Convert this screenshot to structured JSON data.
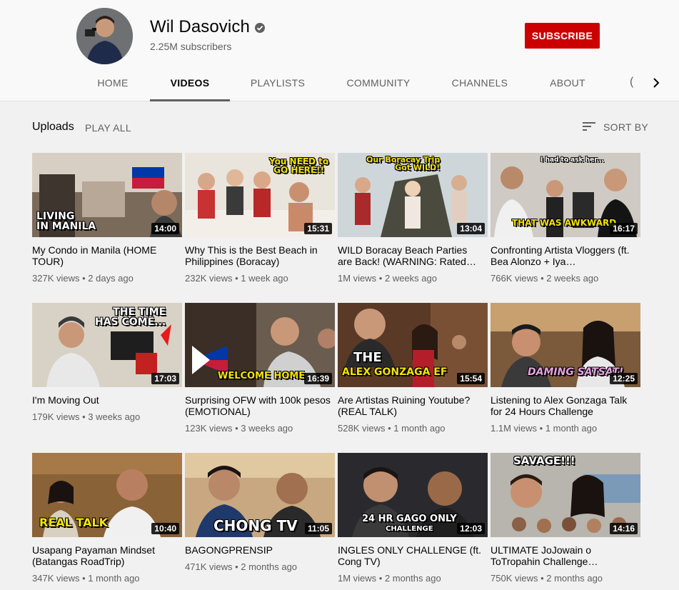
{
  "channel": {
    "name": "Wil Dasovich",
    "subscribers": "2.25M subscribers",
    "subscribe_label": "SUBSCRIBE"
  },
  "tabs": [
    {
      "label": "HOME"
    },
    {
      "label": "VIDEOS"
    },
    {
      "label": "PLAYLISTS"
    },
    {
      "label": "COMMUNITY"
    },
    {
      "label": "CHANNELS"
    },
    {
      "label": "ABOUT"
    }
  ],
  "section": {
    "title": "Uploads",
    "play_all": "PLAY ALL",
    "sort_by": "SORT BY"
  },
  "colors": {
    "subscribe": "#cc0000",
    "page_bg": "#f1f1f1",
    "header_bg": "#f9f9f9"
  },
  "videos": [
    {
      "title": "My Condo in Manila (HOME TOUR)",
      "views": "327K views",
      "age": "2 days ago",
      "duration": "14:00",
      "overlay": "LIVING\nIN MANILA"
    },
    {
      "title": "Why This is the Best Beach in Philippines (Boracay)",
      "views": "232K views",
      "age": "1 week ago",
      "duration": "15:31",
      "overlay": "You NEED to\nGO HERE!!"
    },
    {
      "title": "WILD Boracay Beach Parties are Back! (WARNING: Rated…",
      "views": "1M views",
      "age": "2 weeks ago",
      "duration": "13:04",
      "overlay": "Our Boracay Trip\nGot WILD!"
    },
    {
      "title": "Confronting Artista Vloggers (ft. Bea Alonzo + Iya…",
      "views": "766K views",
      "age": "2 weeks ago",
      "duration": "16:17",
      "overlay": "THAT WAS AWKWARD"
    },
    {
      "title": "I'm Moving Out",
      "views": "179K views",
      "age": "3 weeks ago",
      "duration": "17:03",
      "overlay": "THE TIME\nHAS COME..."
    },
    {
      "title": "Surprising OFW with 100k pesos (EMOTIONAL)",
      "views": "123K views",
      "age": "3 weeks ago",
      "duration": "16:39",
      "overlay": "WELCOME HOME"
    },
    {
      "title": "Are Artistas Ruining Youtube? (REAL TALK)",
      "views": "528K views",
      "age": "1 month ago",
      "duration": "15:54",
      "overlay": "THE\nALEX GONZAGA EFFECT"
    },
    {
      "title": "Listening to Alex Gonzaga Talk for 24 Hours Challenge",
      "views": "1.1M views",
      "age": "1 month ago",
      "duration": "12:25",
      "overlay": "DAMING SATSAT!"
    },
    {
      "title": "Usapang Payaman Mindset (Batangas RoadTrip)",
      "views": "347K views",
      "age": "1 month ago",
      "duration": "10:40",
      "overlay": "REAL TALK"
    },
    {
      "title": "BAGONGPRENSIP",
      "views": "471K views",
      "age": "2 months ago",
      "duration": "11:05",
      "overlay": "CHONG TV"
    },
    {
      "title": "INGLES ONLY CHALLENGE (ft. Cong TV)",
      "views": "1M views",
      "age": "2 months ago",
      "duration": "12:03",
      "overlay": "24 HR GAGO ONLY\nCHALLENGE"
    },
    {
      "title": "ULTIMATE JoJowain o ToTropahin Challenge…",
      "views": "750K views",
      "age": "2 months ago",
      "duration": "14:16",
      "overlay": "SAVAGE!!!"
    }
  ]
}
